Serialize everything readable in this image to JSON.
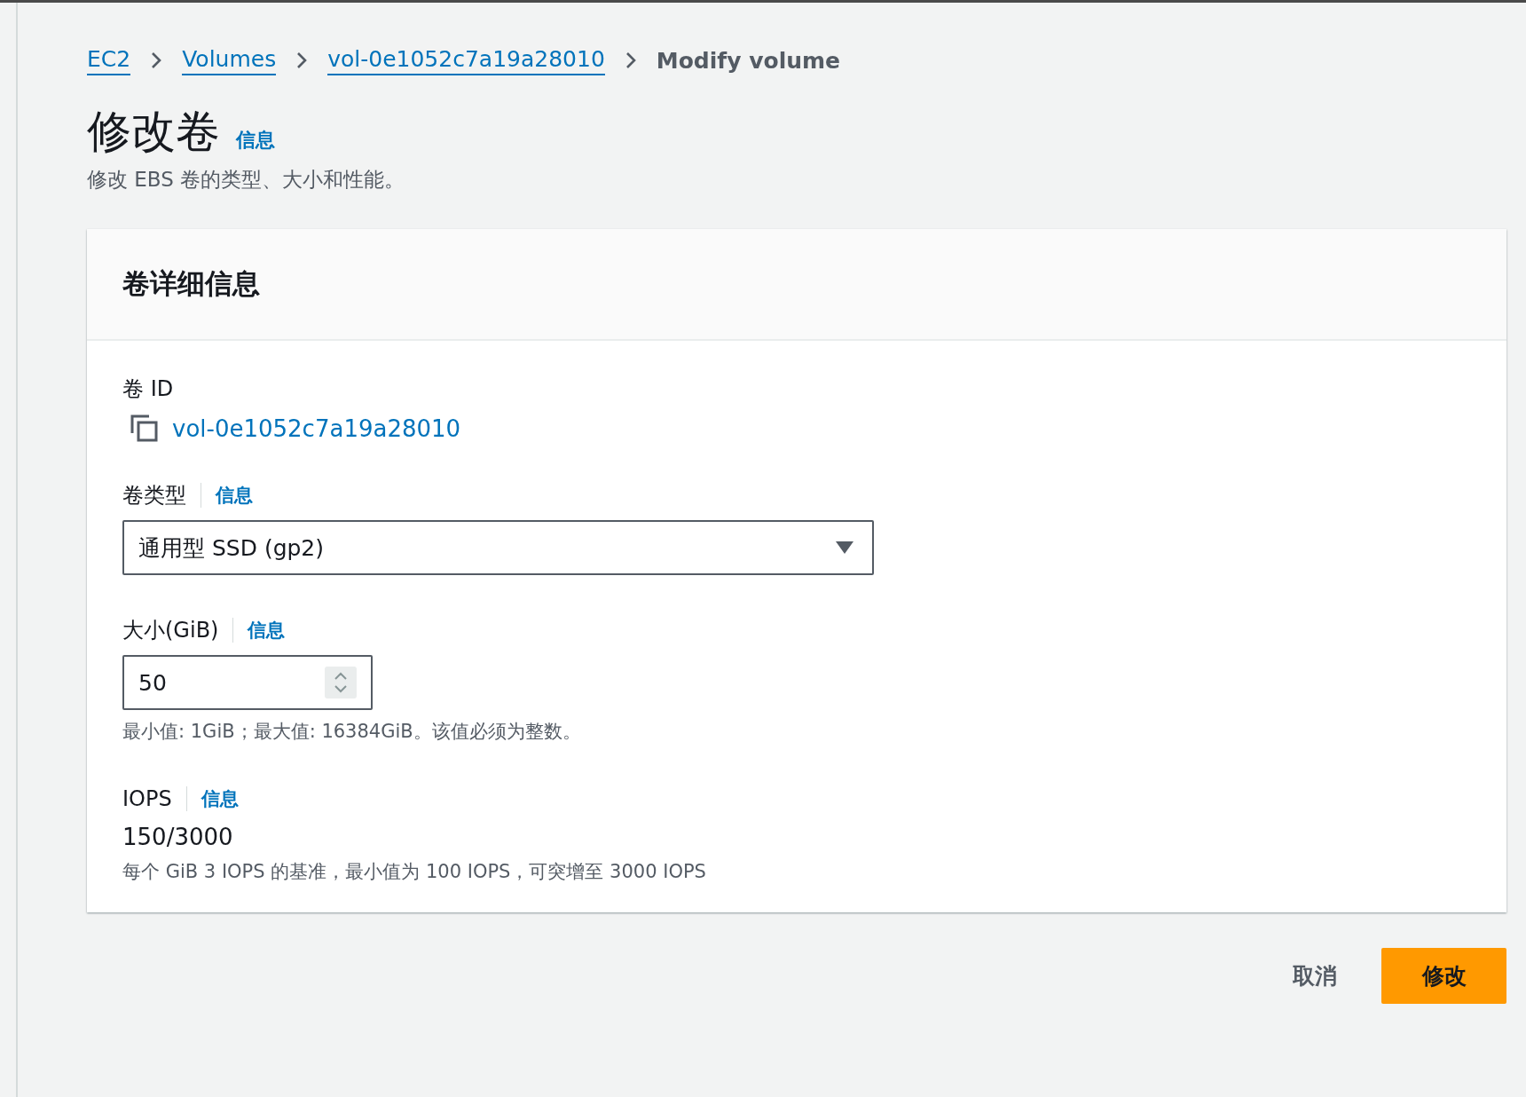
{
  "breadcrumb": [
    {
      "label": "EC2",
      "kind": "link"
    },
    {
      "label": "Volumes",
      "kind": "link"
    },
    {
      "label": "vol-0e1052c7a19a28010",
      "kind": "link"
    },
    {
      "label": "Modify volume",
      "kind": "current"
    }
  ],
  "header": {
    "title": "修改卷",
    "info": "信息",
    "description": "修改 EBS 卷的类型、大小和性能。"
  },
  "panel": {
    "title": "卷详细信息",
    "volume_id": {
      "label": "卷 ID",
      "value": "vol-0e1052c7a19a28010"
    },
    "volume_type": {
      "label": "卷类型",
      "info": "信息",
      "value": "通用型 SSD (gp2)"
    },
    "size": {
      "label": "大小(GiB)",
      "info": "信息",
      "value": "50",
      "hint": "最小值: 1GiB；最大值: 16384GiB。该值必须为整数。"
    },
    "iops": {
      "label": "IOPS",
      "info": "信息",
      "value": "150/3000",
      "hint": "每个 GiB 3 IOPS 的基准，最小值为 100 IOPS，可突增至 3000 IOPS"
    }
  },
  "actions": {
    "cancel": "取消",
    "submit": "修改"
  }
}
